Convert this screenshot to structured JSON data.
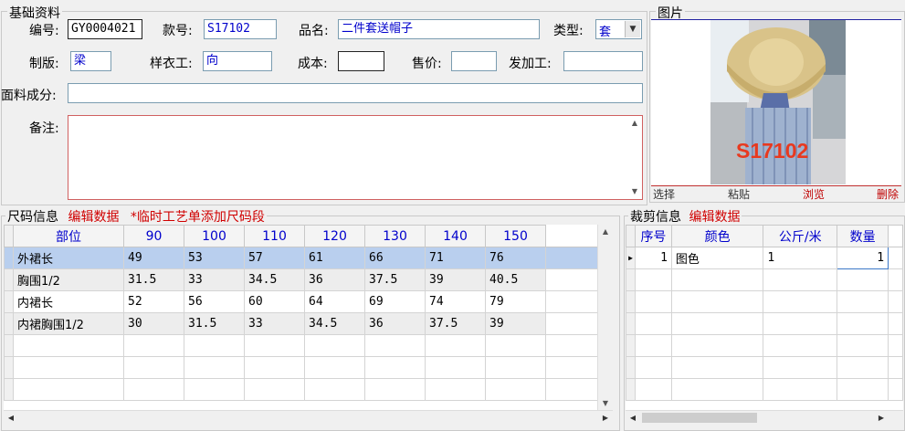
{
  "basic": {
    "legend": "基础资料",
    "code_label": "编号:",
    "code_value": "GY0004021",
    "style_label": "款号:",
    "style_value": "S17102",
    "name_label": "品名:",
    "name_value": "二件套送帽子",
    "type_label": "类型:",
    "type_value": "套",
    "pattern_label": "制版:",
    "pattern_value": "梁",
    "sample_label": "样衣工:",
    "sample_value": "向",
    "cost_label": "成本:",
    "cost_value": "",
    "price_label": "售价:",
    "price_value": "",
    "process_label": "发加工:",
    "process_value": "",
    "fabric_label": "面料成分:",
    "fabric_value": "",
    "remark_label": "备注:",
    "remark_value": ""
  },
  "picture": {
    "legend": "图片",
    "overlay_text": "S17102",
    "btn_select": "选择",
    "btn_paste": "粘贴",
    "btn_browse": "浏览",
    "btn_delete": "删除"
  },
  "size": {
    "legend": "尺码信息",
    "edit_link": "编辑数据",
    "note": "*临时工艺单添加尺码段",
    "columns": [
      "部位",
      "90",
      "100",
      "110",
      "120",
      "130",
      "140",
      "150"
    ],
    "rows": [
      [
        "外裙长",
        "49",
        "53",
        "57",
        "61",
        "66",
        "71",
        "76"
      ],
      [
        "胸围1/2",
        "31.5",
        "33",
        "34.5",
        "36",
        "37.5",
        "39",
        "40.5"
      ],
      [
        "内裙长",
        "52",
        "56",
        "60",
        "64",
        "69",
        "74",
        "79"
      ],
      [
        "内裙胸围1/2",
        "30",
        "31.5",
        "33",
        "34.5",
        "36",
        "37.5",
        "39"
      ]
    ]
  },
  "cut": {
    "legend": "裁剪信息",
    "edit_link": "编辑数据",
    "columns": [
      "序号",
      "颜色",
      "公斤/米",
      "数量"
    ],
    "rows": [
      [
        "1",
        "图色",
        "1",
        "1"
      ]
    ]
  }
}
